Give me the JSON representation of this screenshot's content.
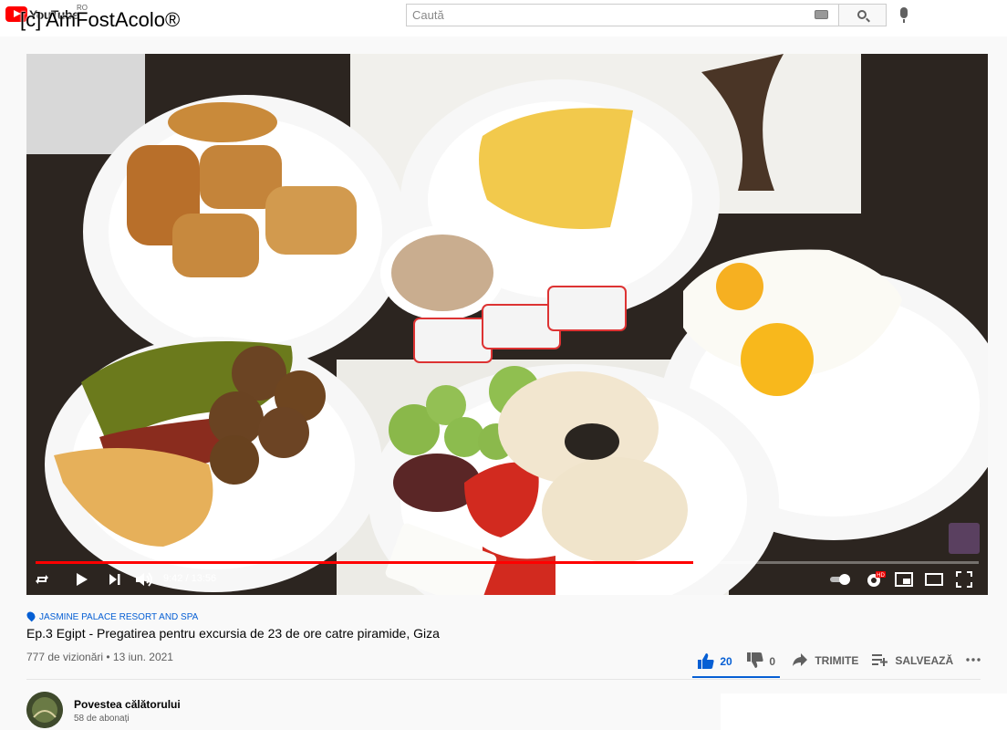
{
  "header": {
    "logo_text": "YouTube",
    "country_code": "RO",
    "watermark": "[c] AmFostAcolo®",
    "search_placeholder": "Caută"
  },
  "player": {
    "current_time": "9:42",
    "duration": "13:56",
    "time_display": "9:42 / 13:56",
    "progress": 0.697,
    "buffered": 0.72,
    "settings_badge": "HD"
  },
  "video": {
    "location": "JASMINE PALACE RESORT AND SPA",
    "title": "Ep.3 Egipt - Pregatirea pentru excursia de 23 de ore catre piramide, Giza",
    "views_date": "777 de vizionări • 13 iun. 2021",
    "likes": "20",
    "dislikes": "0",
    "share_label": "TRIMITE",
    "save_label": "SALVEAZĂ"
  },
  "channel": {
    "name": "Povestea călătorului",
    "subscribers": "58 de abonați"
  },
  "colors": {
    "accent_blue": "#065fd4",
    "progress_red": "#ff0000",
    "brand_red": "#ff0000"
  }
}
